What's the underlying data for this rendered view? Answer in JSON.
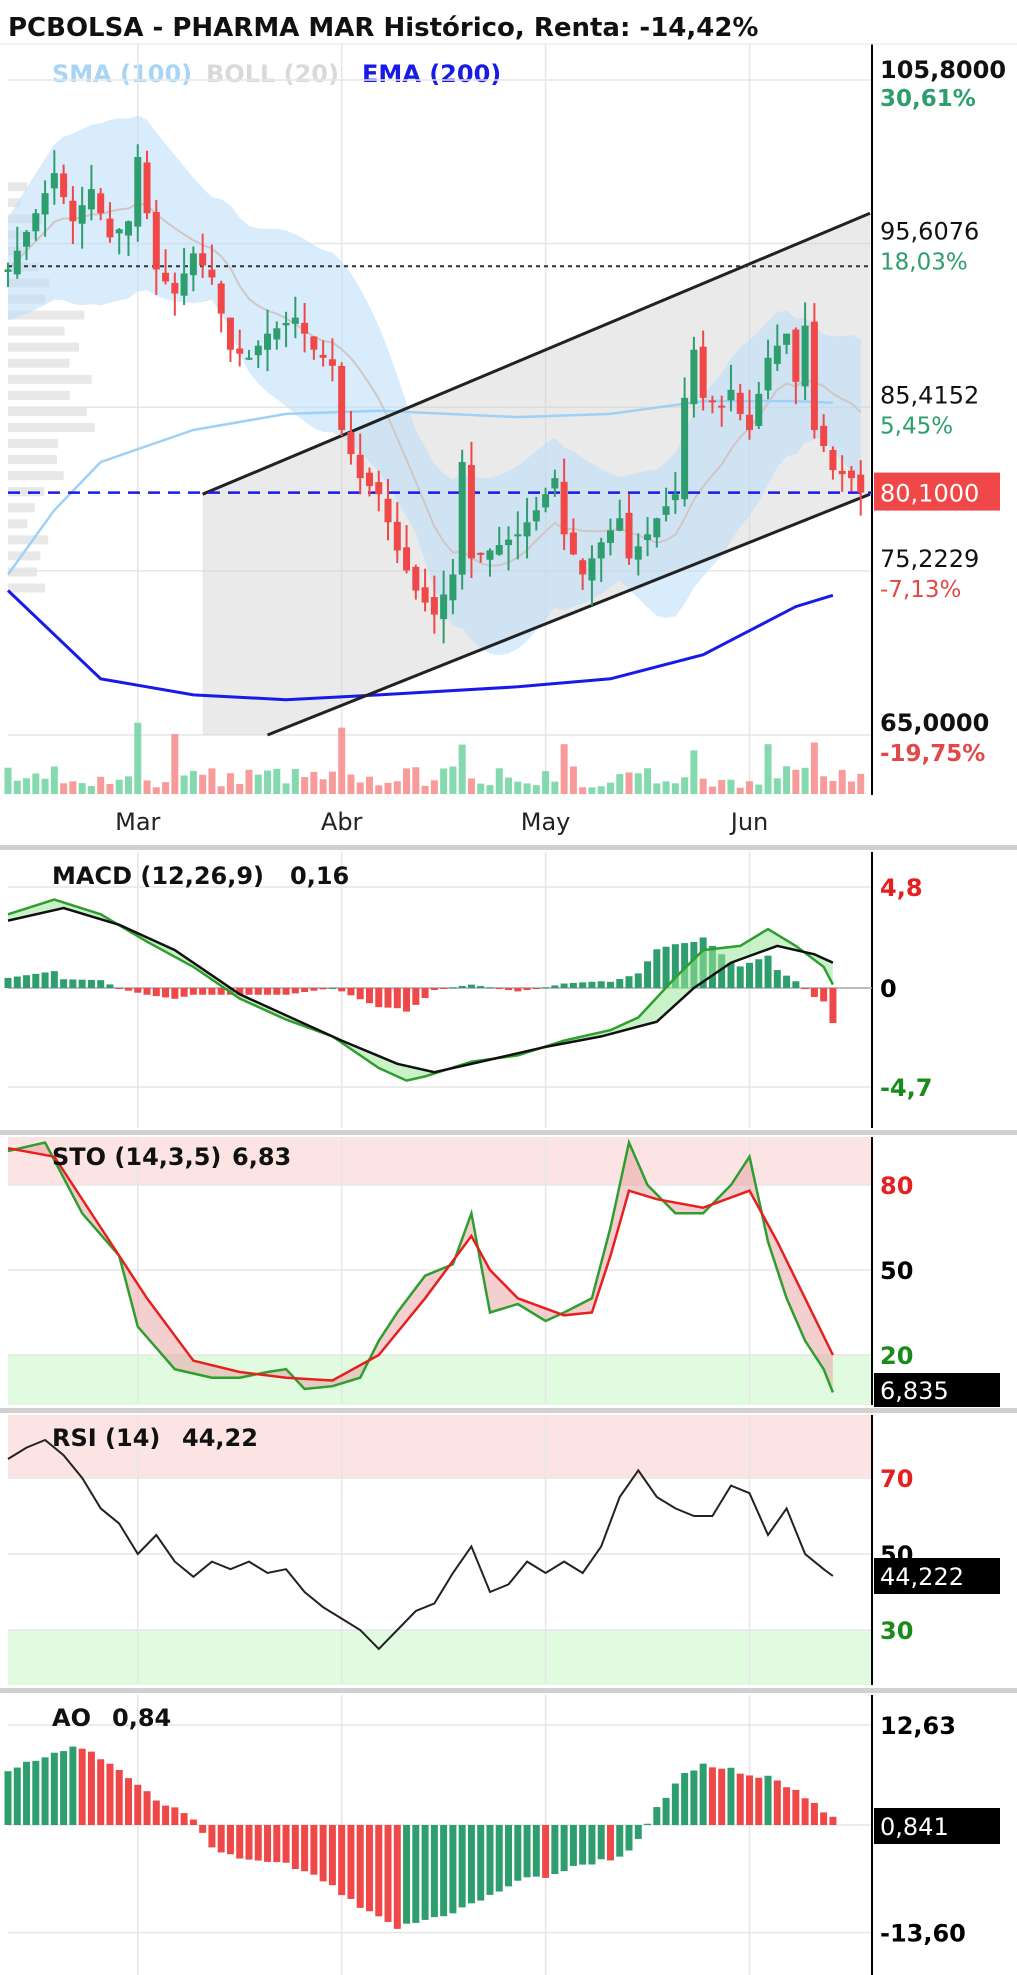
{
  "header": {
    "title": "PCBOLSA - PHARMA MAR Histórico, Renta: -14,42%",
    "legend": [
      {
        "label": "SMA (100)",
        "color": "#a8d4f5"
      },
      {
        "label": "BOLL (20)",
        "color": "#d9d9d9"
      },
      {
        "label": "EMA (200)",
        "color": "#1a1ae6"
      }
    ]
  },
  "colors": {
    "up": "#2e9e6e",
    "down": "#f04848",
    "grid": "#e6e6e6",
    "axis": "#000000",
    "positive_text": "#2e9e6e",
    "negative_text": "#e24848"
  },
  "chart_data": [
    {
      "type": "candlestick",
      "name": "price",
      "x_ticks": [
        "Mar",
        "Abr",
        "May",
        "Jun"
      ],
      "ylim": [
        65.0,
        105.8
      ],
      "right_labels": [
        {
          "price": "105,8000",
          "pct": "30,61%",
          "value": 105.8
        },
        {
          "price": "95,6076",
          "pct": "18,03%",
          "value": 95.6076
        },
        {
          "price": "85,4152",
          "pct": "5,45%",
          "value": 85.4152
        },
        {
          "price": "75,2229",
          "pct": "-7,13%",
          "value": 75.2229
        },
        {
          "price": "65,0000",
          "pct": "-19,75%",
          "value": 65.0
        }
      ],
      "last_price": {
        "label": "80,1000",
        "value": 80.1
      },
      "reference_price": 94.2,
      "close_path": [
        [
          0,
          94.0
        ],
        [
          3,
          97.5
        ],
        [
          5,
          100.0
        ],
        [
          7,
          97.0
        ],
        [
          9,
          99.0
        ],
        [
          11,
          96.0
        ],
        [
          13,
          97.0
        ],
        [
          14,
          101.0
        ],
        [
          16,
          94.0
        ],
        [
          18,
          92.5
        ],
        [
          20,
          95.0
        ],
        [
          22,
          93.5
        ],
        [
          24,
          89.0
        ],
        [
          26,
          88.5
        ],
        [
          28,
          90.0
        ],
        [
          31,
          91.0
        ],
        [
          33,
          89.0
        ],
        [
          35,
          88.0
        ],
        [
          36,
          84.0
        ],
        [
          38,
          81.0
        ],
        [
          40,
          80.0
        ],
        [
          42,
          76.5
        ],
        [
          44,
          74.0
        ],
        [
          46,
          72.5
        ],
        [
          48,
          75.0
        ],
        [
          49,
          82.0
        ],
        [
          50,
          76.0
        ],
        [
          52,
          76.5
        ],
        [
          55,
          77.5
        ],
        [
          57,
          79.0
        ],
        [
          59,
          81.0
        ],
        [
          60,
          77.5
        ],
        [
          62,
          75.0
        ],
        [
          64,
          77.0
        ],
        [
          66,
          78.5
        ],
        [
          67,
          76.0
        ],
        [
          69,
          77.5
        ],
        [
          70,
          78.5
        ],
        [
          72,
          80.0
        ],
        [
          73,
          86.0
        ],
        [
          74,
          89.0
        ],
        [
          75,
          86.0
        ],
        [
          77,
          85.5
        ],
        [
          78,
          86.5
        ],
        [
          79,
          85.0
        ],
        [
          80,
          84.0
        ],
        [
          82,
          88.5
        ],
        [
          84,
          90.0
        ],
        [
          85,
          87.0
        ],
        [
          86,
          90.5
        ],
        [
          87,
          84.0
        ],
        [
          88,
          83.0
        ],
        [
          89,
          81.5
        ],
        [
          91,
          81.0
        ],
        [
          92,
          80.1
        ]
      ],
      "channel": {
        "upper": [
          [
            21,
            80.0
          ],
          [
            93,
            97.5
          ]
        ],
        "lower": [
          [
            28,
            65.0
          ],
          [
            93,
            80.0
          ]
        ]
      },
      "ema200": [
        [
          0,
          74.0
        ],
        [
          10,
          68.5
        ],
        [
          20,
          67.5
        ],
        [
          30,
          67.2
        ],
        [
          40,
          67.5
        ],
        [
          55,
          68.0
        ],
        [
          65,
          68.5
        ],
        [
          75,
          70.0
        ],
        [
          85,
          73.0
        ],
        [
          89,
          73.7
        ]
      ],
      "sma100": [
        [
          0,
          75.0
        ],
        [
          5,
          79.0
        ],
        [
          10,
          82.0
        ],
        [
          15,
          83.0
        ],
        [
          20,
          84.0
        ],
        [
          30,
          85.0
        ],
        [
          40,
          85.2
        ],
        [
          55,
          84.8
        ],
        [
          65,
          85.0
        ],
        [
          75,
          85.8
        ],
        [
          85,
          85.8
        ],
        [
          89,
          85.7
        ]
      ]
    },
    {
      "type": "line",
      "name": "macd",
      "title": "MACD (12,26,9)",
      "value_label": "0,16",
      "ylim": [
        -4.7,
        4.8
      ],
      "right_labels": [
        {
          "label": "4,8",
          "value": 4.8,
          "color": "#e62020"
        },
        {
          "label": "0",
          "value": 0,
          "color": "#000000"
        },
        {
          "label": "-4,7",
          "value": -4.7,
          "color": "#1a8a1a"
        }
      ],
      "macd_line": [
        [
          0,
          3.5
        ],
        [
          5,
          4.2
        ],
        [
          10,
          3.5
        ],
        [
          15,
          2.2
        ],
        [
          20,
          1.0
        ],
        [
          25,
          -0.5
        ],
        [
          30,
          -1.5
        ],
        [
          35,
          -2.3
        ],
        [
          40,
          -3.8
        ],
        [
          43,
          -4.4
        ],
        [
          45,
          -4.2
        ],
        [
          50,
          -3.5
        ],
        [
          55,
          -3.2
        ],
        [
          60,
          -2.5
        ],
        [
          65,
          -2.0
        ],
        [
          68,
          -1.4
        ],
        [
          72,
          0.5
        ],
        [
          75,
          1.8
        ],
        [
          79,
          2.0
        ],
        [
          82,
          2.8
        ],
        [
          85,
          2.0
        ],
        [
          88,
          1.0
        ],
        [
          89,
          0.16
        ]
      ],
      "signal_line": [
        [
          0,
          3.2
        ],
        [
          6,
          3.8
        ],
        [
          12,
          3.0
        ],
        [
          18,
          1.8
        ],
        [
          25,
          -0.3
        ],
        [
          30,
          -1.3
        ],
        [
          36,
          -2.5
        ],
        [
          42,
          -3.6
        ],
        [
          46,
          -4.0
        ],
        [
          52,
          -3.4
        ],
        [
          58,
          -2.8
        ],
        [
          64,
          -2.3
        ],
        [
          70,
          -1.6
        ],
        [
          74,
          0.0
        ],
        [
          78,
          1.2
        ],
        [
          83,
          2.0
        ],
        [
          87,
          1.6
        ],
        [
          89,
          1.2
        ]
      ]
    },
    {
      "type": "line",
      "name": "stochastic",
      "title": "STO (14,3,5)",
      "value_label": "6,83",
      "last_label": "6,835",
      "ylim": [
        0,
        100
      ],
      "overbought": 80,
      "oversold": 20,
      "right_labels": [
        {
          "label": "80",
          "value": 80,
          "color": "#e62020"
        },
        {
          "label": "50",
          "value": 50,
          "color": "#000000"
        },
        {
          "label": "20",
          "value": 20,
          "color": "#1a8a1a"
        }
      ],
      "k_line": [
        [
          0,
          92
        ],
        [
          4,
          95
        ],
        [
          8,
          70
        ],
        [
          12,
          55
        ],
        [
          14,
          30
        ],
        [
          18,
          15
        ],
        [
          22,
          12
        ],
        [
          25,
          12
        ],
        [
          28,
          14
        ],
        [
          30,
          15
        ],
        [
          32,
          8
        ],
        [
          35,
          9
        ],
        [
          38,
          12
        ],
        [
          40,
          25
        ],
        [
          42,
          35
        ],
        [
          45,
          48
        ],
        [
          48,
          52
        ],
        [
          50,
          70
        ],
        [
          52,
          35
        ],
        [
          55,
          38
        ],
        [
          58,
          32
        ],
        [
          60,
          35
        ],
        [
          63,
          40
        ],
        [
          65,
          65
        ],
        [
          67,
          95
        ],
        [
          69,
          80
        ],
        [
          72,
          70
        ],
        [
          75,
          70
        ],
        [
          78,
          80
        ],
        [
          80,
          90
        ],
        [
          82,
          60
        ],
        [
          84,
          40
        ],
        [
          86,
          25
        ],
        [
          88,
          15
        ],
        [
          89,
          6.8
        ]
      ],
      "d_line": [
        [
          0,
          93
        ],
        [
          5,
          90
        ],
        [
          10,
          65
        ],
        [
          15,
          40
        ],
        [
          20,
          18
        ],
        [
          25,
          14
        ],
        [
          30,
          12
        ],
        [
          35,
          11
        ],
        [
          40,
          20
        ],
        [
          45,
          40
        ],
        [
          50,
          62
        ],
        [
          52,
          50
        ],
        [
          55,
          40
        ],
        [
          60,
          34
        ],
        [
          63,
          35
        ],
        [
          65,
          55
        ],
        [
          67,
          78
        ],
        [
          70,
          75
        ],
        [
          75,
          72
        ],
        [
          80,
          78
        ],
        [
          83,
          60
        ],
        [
          86,
          40
        ],
        [
          89,
          20
        ]
      ]
    },
    {
      "type": "line",
      "name": "rsi",
      "title": "RSI (14)",
      "value_label": "44,22",
      "last_label": "44,222",
      "ylim": [
        15,
        85
      ],
      "overbought": 70,
      "oversold": 30,
      "right_labels": [
        {
          "label": "70",
          "value": 70,
          "color": "#e62020"
        },
        {
          "label": "50",
          "value": 50,
          "color": "#000000"
        },
        {
          "label": "30",
          "value": 30,
          "color": "#1a8a1a"
        }
      ],
      "rsi_line": [
        [
          0,
          75
        ],
        [
          2,
          78
        ],
        [
          4,
          80
        ],
        [
          6,
          76
        ],
        [
          8,
          70
        ],
        [
          10,
          62
        ],
        [
          12,
          58
        ],
        [
          14,
          50
        ],
        [
          16,
          55
        ],
        [
          18,
          48
        ],
        [
          20,
          44
        ],
        [
          22,
          48
        ],
        [
          24,
          46
        ],
        [
          26,
          48
        ],
        [
          28,
          45
        ],
        [
          30,
          46
        ],
        [
          32,
          40
        ],
        [
          34,
          36
        ],
        [
          36,
          33
        ],
        [
          38,
          30
        ],
        [
          40,
          25
        ],
        [
          42,
          30
        ],
        [
          44,
          35
        ],
        [
          46,
          37
        ],
        [
          48,
          45
        ],
        [
          50,
          52
        ],
        [
          52,
          40
        ],
        [
          54,
          42
        ],
        [
          56,
          48
        ],
        [
          58,
          45
        ],
        [
          60,
          48
        ],
        [
          62,
          45
        ],
        [
          64,
          52
        ],
        [
          66,
          65
        ],
        [
          68,
          72
        ],
        [
          70,
          65
        ],
        [
          72,
          62
        ],
        [
          74,
          60
        ],
        [
          76,
          60
        ],
        [
          78,
          68
        ],
        [
          80,
          66
        ],
        [
          82,
          55
        ],
        [
          84,
          62
        ],
        [
          86,
          50
        ],
        [
          88,
          46
        ],
        [
          89,
          44.2
        ]
      ]
    },
    {
      "type": "bar",
      "name": "ao",
      "title": "AO",
      "value_label": "0,84",
      "last_label": "0,841",
      "ylim": [
        -13.6,
        12.63
      ],
      "right_labels": [
        {
          "label": "12,63",
          "value": 12.63,
          "color": "#000000"
        },
        {
          "label": "-13,60",
          "value": -13.6,
          "color": "#000000"
        }
      ],
      "ao_path": [
        [
          0,
          7.0
        ],
        [
          4,
          8.5
        ],
        [
          7,
          10.0
        ],
        [
          9,
          9.0
        ],
        [
          12,
          7.0
        ],
        [
          15,
          4.0
        ],
        [
          18,
          2.0
        ],
        [
          20,
          0.5
        ],
        [
          22,
          -3.0
        ],
        [
          26,
          -4.5
        ],
        [
          30,
          -5.0
        ],
        [
          34,
          -7.0
        ],
        [
          38,
          -10.5
        ],
        [
          42,
          -13.0
        ],
        [
          45,
          -12.0
        ],
        [
          48,
          -11.0
        ],
        [
          52,
          -9.0
        ],
        [
          55,
          -7.0
        ],
        [
          58,
          -6.5
        ],
        [
          62,
          -5.0
        ],
        [
          66,
          -4.0
        ],
        [
          68,
          -2.0
        ],
        [
          70,
          2.0
        ],
        [
          73,
          6.5
        ],
        [
          75,
          7.5
        ],
        [
          78,
          7.0
        ],
        [
          80,
          6.0
        ],
        [
          82,
          6.5
        ],
        [
          84,
          5.0
        ],
        [
          86,
          3.5
        ],
        [
          88,
          1.5
        ],
        [
          89,
          0.84
        ]
      ]
    }
  ]
}
